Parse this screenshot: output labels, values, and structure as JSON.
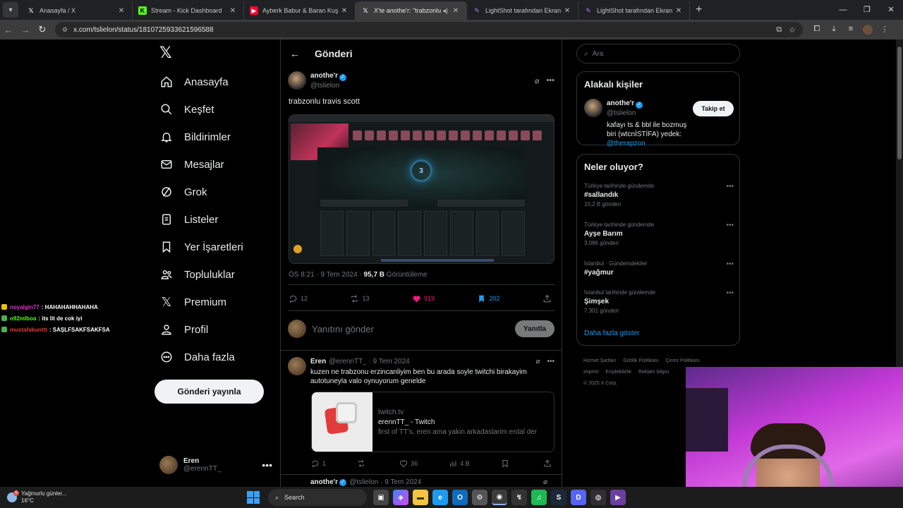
{
  "browser": {
    "tabs": [
      {
        "title": "Anasayfa / X",
        "favicon": "x-icon",
        "active": false
      },
      {
        "title": "Stream - Kick Dashboard",
        "favicon": "kick-icon",
        "active": false
      },
      {
        "title": "Ayberk Babur & Baran Kuş - M",
        "favicon": "youtube-icon",
        "active": false
      },
      {
        "title": "X'te anothe'r: \"trabzonlu tr",
        "favicon": "x-icon",
        "active": true
      },
      {
        "title": "LightShot tarafından Ekran Gör",
        "favicon": "lightshot-icon",
        "active": false
      },
      {
        "title": "LightShot tarafından Ekran Gör",
        "favicon": "lightshot-icon",
        "active": false
      }
    ],
    "url": "x.com/tslielon/status/1810725933621596588"
  },
  "nav": {
    "items": [
      {
        "label": "Anasayfa",
        "icon": "home-icon"
      },
      {
        "label": "Keşfet",
        "icon": "search-icon"
      },
      {
        "label": "Bildirimler",
        "icon": "bell-icon"
      },
      {
        "label": "Mesajlar",
        "icon": "mail-icon"
      },
      {
        "label": "Grok",
        "icon": "grok-icon"
      },
      {
        "label": "Listeler",
        "icon": "list-icon"
      },
      {
        "label": "Yer İşaretleri",
        "icon": "bookmark-icon"
      },
      {
        "label": "Topluluklar",
        "icon": "communities-icon"
      },
      {
        "label": "Premium",
        "icon": "x-icon"
      },
      {
        "label": "Profil",
        "icon": "profile-icon"
      },
      {
        "label": "Daha fazla",
        "icon": "more-circle-icon"
      }
    ],
    "post_button": "Gönderi yayınla",
    "account": {
      "name": "Eren",
      "handle": "@erennTT_"
    }
  },
  "chat": [
    {
      "user": "noyalgin77",
      "message": ": HAHAHAHHAHAHA"
    },
    {
      "user": "o92mlboa",
      "message": ": its lit de cok iyi"
    },
    {
      "user": "mustafakunttt",
      "message": ": SAŞLFSAKFSAKFSA"
    }
  ],
  "main": {
    "header_title": "Gönderi",
    "post": {
      "author_name": "anothe'r",
      "handle": "@tslielon",
      "text": "trabzonlu travis scott",
      "media_counter": "3",
      "time": "ÖS 8:21 · 9 Tem 2024 · ",
      "views_count": "95,7 B",
      "views_label": " Görüntüleme",
      "replies": "12",
      "reposts": "13",
      "likes": "919",
      "bookmarks": "202"
    },
    "reply_box": {
      "placeholder": "Yanıtını gönder",
      "button": "Yanıtla"
    },
    "reply": {
      "author_name": "Eren",
      "handle_date": "@erennTT_ · 9 Tem 2024",
      "text": "kuzen ne trabzonu erzincanliyim ben bu arada soyle twitchi birakayim autotuneyla valo oynuyorum genelde",
      "card": {
        "domain": "twitch.tv",
        "title": "erennTT_ - Twitch",
        "description": "first of TT's, eren ama yakin arkadaslarim erdal der"
      },
      "replies": "1",
      "likes": "36",
      "views": "4 B"
    },
    "next_post": {
      "author_name": "anothe'r",
      "handle_date": "@tslielon · 9 Tem 2024"
    }
  },
  "sidebar": {
    "search_placeholder": "Ara",
    "related": {
      "title": "Alakalı kişiler",
      "name": "anothe'r",
      "handle": "@tslielon",
      "bio": "kafayı ts & bbl ile bozmuş biri (wtcnİSTİFA) yedek: ",
      "bio_link": "@therapzon",
      "follow_label": "Takip et"
    },
    "trends": {
      "title": "Neler oluyor?",
      "items": [
        {
          "context": "Türkiye tarihinde gündemde",
          "topic": "#sallandık",
          "count": "10,2 B gönderi"
        },
        {
          "context": "Türkiye tarihinde gündemde",
          "topic": "Ayşe Barım",
          "count": "3.086 gönderi"
        },
        {
          "context": "İstanbul · Gündemdekiler",
          "topic": "#yağmur",
          "count": ""
        },
        {
          "context": "İstanbul tarihinde gündemde",
          "topic": "Şimşek",
          "count": "7.301 gönderi"
        }
      ],
      "show_more": "Daha fazla göster"
    },
    "footer": [
      "Hizmet Şartları",
      "Gizlilik Politikası",
      "Çerez Politikası",
      "Imprint",
      "Erişilebilirlik",
      "Reklam bilgisi",
      "© 2025 X Corp."
    ]
  },
  "taskbar": {
    "weather_text": "Yağmurlu günler...",
    "weather_temp": "16°C",
    "weather_badge": "6",
    "search_label": "Search"
  },
  "colors": {
    "accent": "#1d9bf0",
    "like": "#f91880",
    "background": "#000000"
  }
}
